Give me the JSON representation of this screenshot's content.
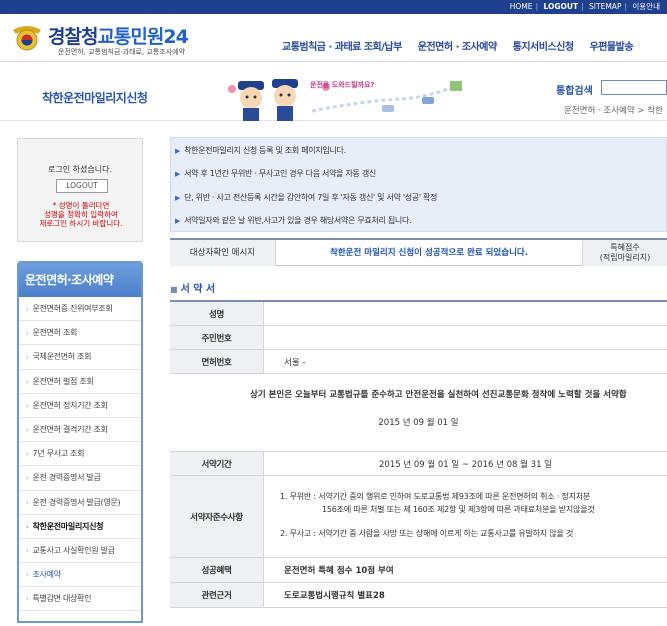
{
  "topbar": {
    "home": "HOME",
    "logout": "LOGOUT",
    "sitemap": "SITEMAP",
    "english": "이용안내"
  },
  "header": {
    "logo_part1": "경찰청",
    "logo_part2": "교통민원24",
    "logo_sub": "운전면허, 교통범칙금·과태료, 교통조사예약",
    "gnb": [
      "교통범칙금 · 과태료 조회/납부",
      "운전면허 · 조사예약",
      "통지서비스신청",
      "우편물발송"
    ]
  },
  "banner": {
    "title": "착한운전마일리지신청",
    "speech": "운전을 도와드릴까요?",
    "search_label": "통합검색",
    "search_placeholder": "",
    "breadcrumb": "운전면허 · 조사예약 > 착한"
  },
  "login": {
    "message": "로그인 하셨습니다.",
    "logout_btn": "LOGOUT",
    "warning_l1": "* 성명이 틀리다면",
    "warning_l2": "성명을 정확히 입력하여",
    "warning_l3": "재로그인 하시기 바랍니다."
  },
  "lnb": {
    "title": "운전면허·조사예약",
    "items": [
      "운전면허증 진위여부조회",
      "운전면허 조회",
      "국제운전면허 조회",
      "운전면허 벌점 조회",
      "운전면허 정지기간 조회",
      "운전면허 결격기간 조회",
      "7년 무사고 조회",
      "운전 경력증명서 발급",
      "운전 경력증명서 발급(영문)",
      "착한운전마일리지신청",
      "교통사고 사실확인원 발급",
      "조사예약",
      "특별감면 대상확인"
    ]
  },
  "notice": [
    "착한운전마일리지 신청 등록 및 조회 페이지입니다.",
    "서약 후 1년간 무위반 · 무사고인 경우 다음 서약을 자동 갱신",
    "단, 위반 · 사고 전산등록 시간을 감안하여 7일 후 '자동 갱신' 및 서약 '성공' 확정",
    "서약일자와 같은 날 위반,사고가 있을 경우 해당서약은 무효처리 됩니다."
  ],
  "status": {
    "label": "대상자확인 메시지",
    "message": "착한운전 마일리지 신청이 성공적으로 완료 되었습니다.",
    "points_l1": "특혜점수",
    "points_l2": "(적립마일리지)"
  },
  "section_title": "서 약 서",
  "form": {
    "name_label": "성명",
    "name_value": "",
    "rrn_label": "주민번호",
    "rrn_value": "",
    "license_label": "면허번호",
    "license_value": "서울 -",
    "pledge_text": "상기 본인은 오늘부터 교통법규를 준수하고 안전운전을 실천하여 선진교통문화 정착에 노력할 것을 서약합",
    "pledge_date": "2015 년 09 월 01 일",
    "period_label": "서약기간",
    "period_value": "2015 년 09 월 01 일 ~ 2016 년 08 월 31 일",
    "obligations_label": "서약자준수사항",
    "obl_1a": "1. 무위반 : 서약기간 중의 행위로 인하여 도로교통법 제93조에 따른 운전면허의 취소 · 정지처분",
    "obl_1b": "156조에 따른 처벌 또는 제 160조 제2항 및 제3항에 따른 과태료처분을 받지않을것",
    "obl_2": "2. 무사고 : 서약기간 중 사람을 사망 또는 상해에 이르게 하는 교통사고를 유발하지 않을 것",
    "benefit_label": "성공혜택",
    "benefit_value": "운전면허 특혜 점수 10점 부여",
    "legal_label": "관련근거",
    "legal_value": "도로교통법시행규칙 별표28"
  }
}
